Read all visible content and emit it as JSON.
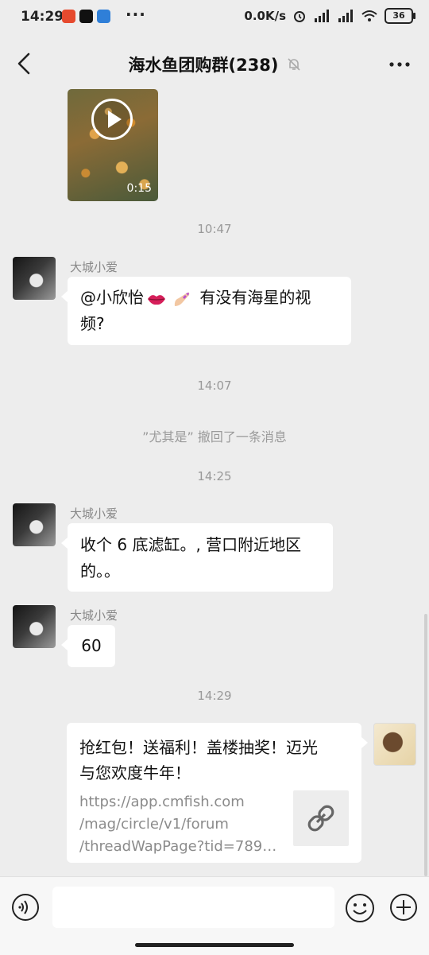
{
  "status_bar": {
    "time": "14:29",
    "network_speed": "0.0K/s",
    "battery": "36",
    "more": "···"
  },
  "header": {
    "title": "海水鱼团购群(238)"
  },
  "messages": {
    "video": {
      "duration": "0:15"
    },
    "ts1": "10:47",
    "msg1": {
      "sender": "大城小爱",
      "text_a": "@小欣怡",
      "text_b": " 有没有海星的视",
      "text_c": "频?"
    },
    "ts2": "14:07",
    "recall": "”尤其是” 撤回了一条消息",
    "ts3": "14:25",
    "msg2": {
      "sender": "大城小爱",
      "line1": "收个 6 底滤缸。, 营口附近地区",
      "line2": "的。。"
    },
    "msg3": {
      "sender": "大城小爱",
      "text": "60"
    },
    "ts4": "14:29",
    "link": {
      "title_line1": "抢红包！送福利！盖楼抽奖！迈光",
      "title_line2": "与您欢度牛年！",
      "url_line1": "https://app.cmfish.com",
      "url_line2": "/mag/circle/v1/forum",
      "url_line3": "/threadWapPage?tid=789…"
    }
  },
  "colors": {
    "background": "#ededed",
    "bubble": "#ffffff",
    "muted_text": "#999999"
  },
  "icons": [
    "back-arrow-icon",
    "mute-bell-icon",
    "more-dots-icon",
    "play-icon",
    "link-icon",
    "voice-icon",
    "emoji-icon",
    "plus-icon"
  ]
}
